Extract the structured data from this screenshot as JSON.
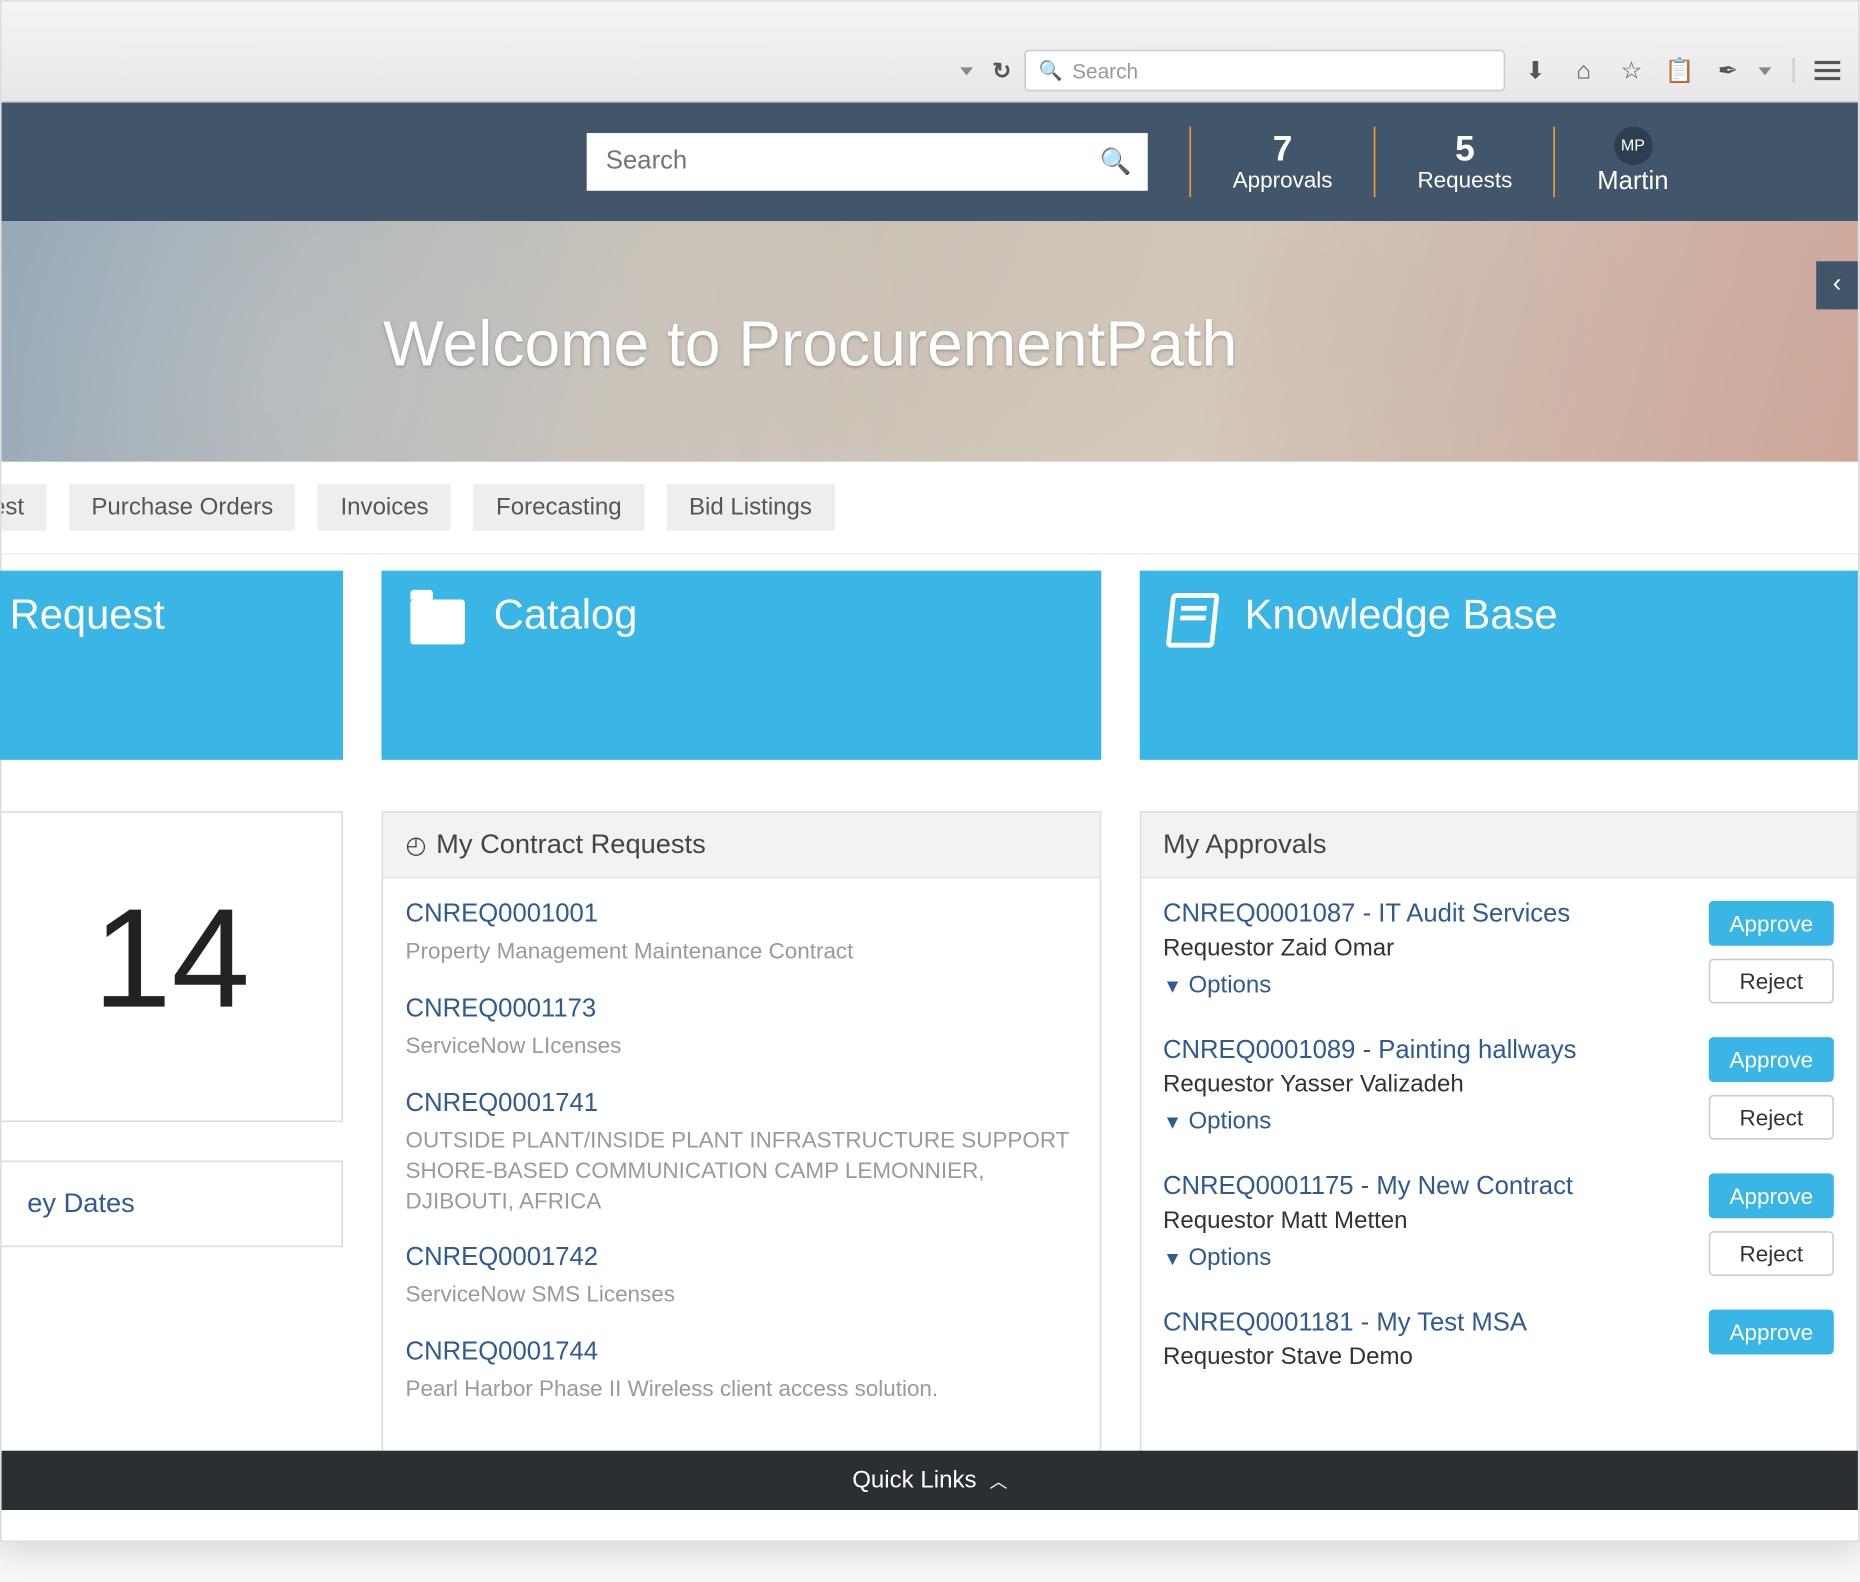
{
  "browser": {
    "search_placeholder": "Search"
  },
  "header": {
    "search_placeholder": "Search",
    "approvals_count": "7",
    "approvals_label": "Approvals",
    "requests_count": "5",
    "requests_label": "Requests",
    "user_initials": "MP",
    "user_name": "Martin"
  },
  "banner": {
    "title": "Welcome to ProcurementPath"
  },
  "nav": {
    "items": [
      "est",
      "Purchase Orders",
      "Invoices",
      "Forecasting",
      "Bid Listings"
    ]
  },
  "tiles": {
    "request": "Request",
    "catalog": "Catalog",
    "knowledge": "Knowledge Base"
  },
  "left": {
    "big_number": "14",
    "link": "ey Dates"
  },
  "contract_requests": {
    "title": "My Contract Requests",
    "items": [
      {
        "id": "CNREQ0001001",
        "desc": "Property Management Maintenance Contract"
      },
      {
        "id": "CNREQ0001173",
        "desc": "ServiceNow LIcenses"
      },
      {
        "id": "CNREQ0001741",
        "desc": "OUTSIDE PLANT/INSIDE PLANT INFRASTRUCTURE SUPPORT SHORE-BASED COMMUNICATION CAMP LEMONNIER, DJIBOUTI, AFRICA"
      },
      {
        "id": "CNREQ0001742",
        "desc": "ServiceNow SMS Licenses"
      },
      {
        "id": "CNREQ0001744",
        "desc": "Pearl Harbor Phase II Wireless client access solution."
      }
    ]
  },
  "approvals": {
    "title": "My Approvals",
    "options_label": "Options",
    "approve_label": "Approve",
    "reject_label": "Reject",
    "items": [
      {
        "id": "CNREQ0001087 - IT Audit Services",
        "requestor": "Requestor Zaid Omar"
      },
      {
        "id": "CNREQ0001089 - Painting hallways",
        "requestor": "Requestor Yasser Valizadeh"
      },
      {
        "id": "CNREQ0001175 - My New Contract",
        "requestor": "Requestor Matt Metten"
      },
      {
        "id": "CNREQ0001181 - My Test MSA",
        "requestor": "Requestor Stave Demo"
      }
    ]
  },
  "footer": {
    "label": "Quick Links"
  }
}
